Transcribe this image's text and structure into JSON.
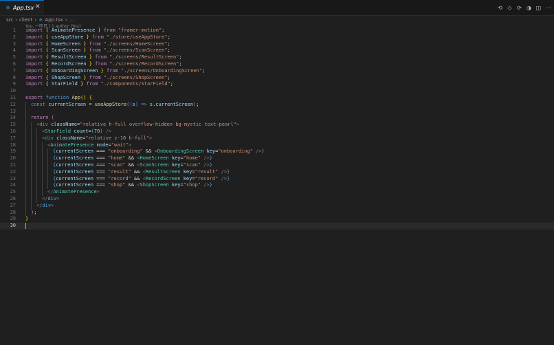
{
  "tab": {
    "icon": "react-icon",
    "label": "App.tsx",
    "close": "✕"
  },
  "breadcrumb": {
    "parts": [
      "src",
      "client",
      "App.tsx",
      "..."
    ]
  },
  "blame": "You, 一昨日 | 1 author (You)",
  "lines": [
    "1",
    "2",
    "3",
    "4",
    "5",
    "6",
    "7",
    "8",
    "9",
    "10",
    "11",
    "12",
    "13",
    "14",
    "15",
    "16",
    "17",
    "18",
    "19",
    "20",
    "21",
    "22",
    "23",
    "24",
    "25",
    "26",
    "27",
    "28",
    "29",
    "30"
  ],
  "code": {
    "l1": [
      "import",
      "{",
      " AnimatePresence ",
      "}",
      " from ",
      "\"framer-motion\"",
      ";"
    ],
    "l2": [
      "import",
      "{",
      " useAppStore ",
      "}",
      " from ",
      "\"./store/useAppStore\"",
      ";"
    ],
    "l3": [
      "import",
      "{",
      " HomeScreen ",
      "}",
      " from ",
      "\"./screens/HomeScreen\"",
      ";"
    ],
    "l4": [
      "import",
      "{",
      " ScanScreen ",
      "}",
      " from ",
      "\"./screens/ScanScreen\"",
      ";"
    ],
    "l5": [
      "import",
      "{",
      " ResultScreen ",
      "}",
      " from ",
      "\"./screens/ResultScreen\"",
      ";"
    ],
    "l6": [
      "import",
      "{",
      " RecordScreen ",
      "}",
      " from ",
      "\"./screens/RecordScreen\"",
      ";"
    ],
    "l7": [
      "import",
      "{",
      " OnboardingScreen ",
      "}",
      " from ",
      "\"./screens/OnboardingScreen\"",
      ";"
    ],
    "l8": [
      "import",
      "{",
      " ShopScreen ",
      "}",
      " from ",
      "\"./screens/ShopScreen\"",
      ";"
    ],
    "l9": [
      "import",
      "{",
      " StarField ",
      "}",
      " from ",
      "\"./components/StarField\"",
      ";"
    ],
    "l11": [
      "export",
      "function",
      "App",
      "(",
      ")",
      "{"
    ],
    "l12": [
      "const",
      "currentScreen",
      "=",
      "useAppStore",
      "(",
      "(",
      "s",
      ")",
      "=>",
      "s",
      ".currentScreen",
      ")",
      ")",
      ";"
    ],
    "l14": [
      "return",
      "("
    ],
    "l15": [
      "<",
      "div",
      "className",
      "=",
      "\"relative h-full overflow-hidden bg-mystic text-pearl\"",
      ">"
    ],
    "l16": [
      "<",
      "StarField",
      "count",
      "=",
      "{",
      "70",
      "}",
      "/>"
    ],
    "l17": [
      "<",
      "div",
      "className",
      "=",
      "\"relative z-10 h-full\"",
      ">"
    ],
    "l18": [
      "<",
      "AnimatePresence",
      "mode",
      "=",
      "\"wait\"",
      ">"
    ],
    "l19": [
      "{",
      "currentScreen",
      "===",
      "\"onboarding\"",
      "&&",
      "<",
      "OnboardingScreen",
      "key",
      "=",
      "\"onboarding\"",
      "/>",
      "}"
    ],
    "l20": [
      "{",
      "currentScreen",
      "===",
      "\"home\"",
      "&&",
      "<",
      "HomeScreen",
      "key",
      "=",
      "\"home\"",
      "/>",
      "}"
    ],
    "l21": [
      "{",
      "currentScreen",
      "===",
      "\"scan\"",
      "&&",
      "<",
      "ScanScreen",
      "key",
      "=",
      "\"scan\"",
      "/>",
      "}"
    ],
    "l22": [
      "{",
      "currentScreen",
      "===",
      "\"result\"",
      "&&",
      "<",
      "ResultScreen",
      "key",
      "=",
      "\"result\"",
      "/>",
      "}"
    ],
    "l23": [
      "{",
      "currentScreen",
      "===",
      "\"record\"",
      "&&",
      "<",
      "RecordScreen",
      "key",
      "=",
      "\"record\"",
      "/>",
      "}"
    ],
    "l24": [
      "{",
      "currentScreen",
      "===",
      "\"shop\"",
      "&&",
      "<",
      "ShopScreen",
      "key",
      "=",
      "\"shop\"",
      "/>",
      "}"
    ],
    "l25": [
      "</",
      "AnimatePresence",
      ">"
    ],
    "l26": [
      "</",
      "div",
      ">"
    ],
    "l27": [
      "</",
      "div",
      ">"
    ],
    "l28": [
      ")",
      ";"
    ],
    "l29": [
      "}"
    ]
  },
  "colors": {
    "accent": "#0078d4",
    "background": "#1f1f1f",
    "tabbar": "#181818"
  }
}
